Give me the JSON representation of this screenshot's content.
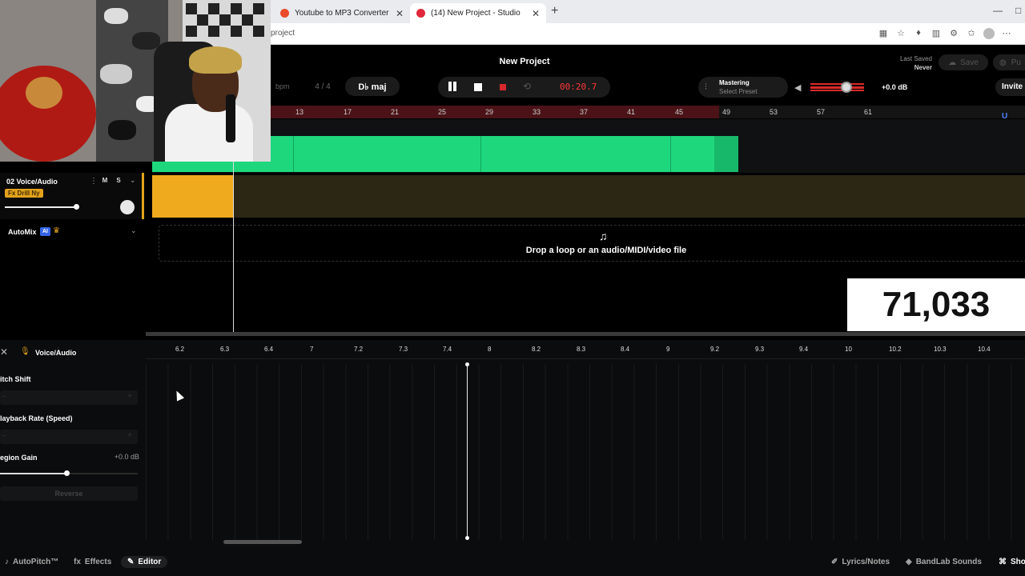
{
  "browser": {
    "tabs": [
      {
        "title": "Youtube to MP3 Converter",
        "active": false,
        "favicon_color": "#ea4b2a"
      },
      {
        "title": "(14) New Project - Studio",
        "active": true,
        "favicon_color": "#e0283a"
      }
    ],
    "url": "project"
  },
  "header": {
    "project_title": "New Project",
    "last_saved_label": "Last Saved",
    "last_saved_value": "Never",
    "save_label": "Save",
    "publish_label": "Pu",
    "bpm_label": "bpm",
    "time_signature": "4 / 4",
    "key": "D♭ maj",
    "time": "00:20.7",
    "mastering_label": "Mastering",
    "mastering_preset": "Select Preset",
    "volume_db": "+0.0 dB",
    "invite_label": "Invite"
  },
  "ruler": {
    "labels": [
      "13",
      "17",
      "21",
      "25",
      "29",
      "33",
      "37",
      "41",
      "45",
      "49",
      "53",
      "57",
      "61"
    ]
  },
  "tracks": {
    "track2": {
      "number_name": "02 Voice/Audio",
      "fx": "Fx Drill Ny",
      "mute": "M",
      "solo": "S",
      "clip_color": "#f0aa1e"
    },
    "automix_label": "AutoMix",
    "automix_badge": "AI"
  },
  "dropzone": {
    "text": "Drop a loop or an audio/MIDI/video file"
  },
  "counter": "71,033",
  "editor": {
    "track_label": "Voice/Audio",
    "pitch_shift": "itch Shift",
    "playback_rate": "layback Rate (Speed)",
    "region_gain": "egion Gain",
    "region_gain_value": "+0.0 dB",
    "reverse": "Reverse",
    "ticks": [
      "6.2",
      "6.3",
      "6.4",
      "7",
      "7.2",
      "7.3",
      "7.4",
      "8",
      "8.2",
      "8.3",
      "8.4",
      "9",
      "9.2",
      "9.3",
      "9.4",
      "10",
      "10.2",
      "10.3",
      "10.4"
    ]
  },
  "bottombar": {
    "autopitch": "AutoPitch™",
    "effects": "Effects",
    "editor": "Editor",
    "lyrics": "Lyrics/Notes",
    "sounds": "BandLab Sounds",
    "shortcuts": "Sho"
  },
  "colors": {
    "accent_green": "#1ed77d",
    "accent_orange": "#f0aa1e",
    "record_red": "#d6282c"
  }
}
